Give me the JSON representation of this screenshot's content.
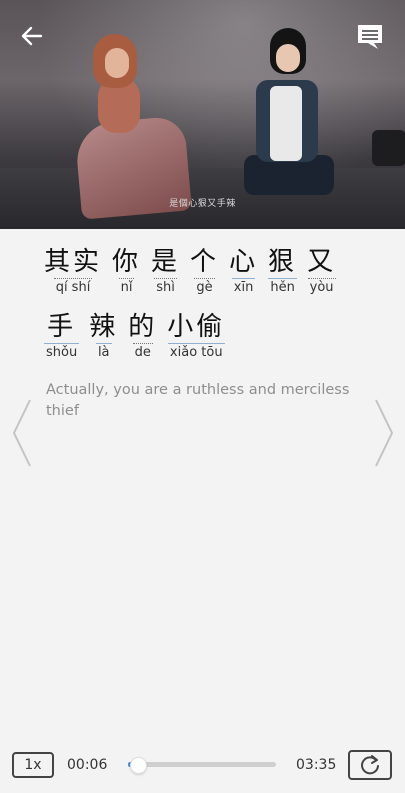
{
  "video": {
    "subtitle": "是個心狠又手辣"
  },
  "lyrics": {
    "line1": [
      {
        "hanzi": "其实",
        "pinyin": "qí shí",
        "underline": "dotted"
      },
      {
        "hanzi": "你",
        "pinyin": "nǐ",
        "underline": "dotted"
      },
      {
        "hanzi": "是",
        "pinyin": "shì",
        "underline": "dotted"
      },
      {
        "hanzi": "个",
        "pinyin": "gè",
        "underline": "dotted"
      },
      {
        "hanzi": "心",
        "pinyin": "xīn",
        "underline": "blue"
      },
      {
        "hanzi": "狠",
        "pinyin": "hěn",
        "underline": "blue"
      },
      {
        "hanzi": "又",
        "pinyin": "yòu",
        "underline": "dotted"
      }
    ],
    "line2": [
      {
        "hanzi": "手",
        "pinyin": "shǒu",
        "underline": "blue"
      },
      {
        "hanzi": "辣",
        "pinyin": "là",
        "underline": "blue"
      },
      {
        "hanzi": "的",
        "pinyin": "de",
        "underline": "dotted"
      },
      {
        "hanzi": "小偷",
        "pinyin": "xiǎo tōu",
        "underline": "blue"
      }
    ],
    "translation": "Actually, you are a ruthless and merciless thief"
  },
  "player": {
    "speed_label": "1x",
    "current_time": "00:06",
    "total_time": "03:35",
    "progress": 0.03
  },
  "icons": {
    "back": "back-arrow-icon",
    "chat": "chat-bubble-icon",
    "prev": "chevron-left-icon",
    "next": "chevron-right-icon",
    "replay": "replay-icon"
  },
  "colors": {
    "accent": "#4a90d9"
  }
}
